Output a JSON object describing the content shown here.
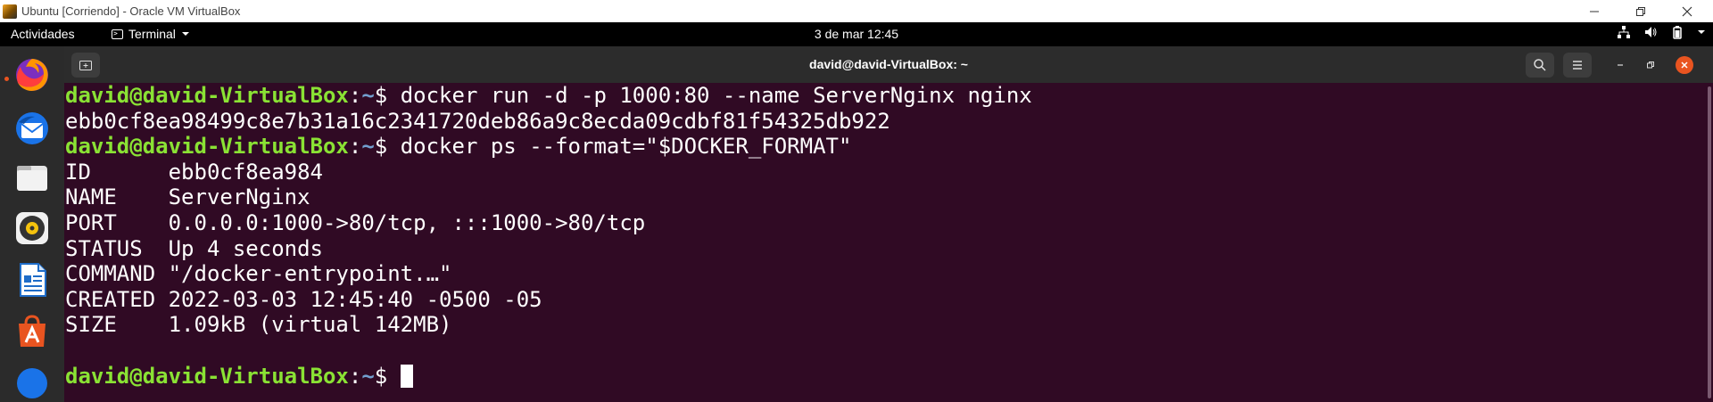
{
  "vbox": {
    "title": "Ubuntu [Corriendo] - Oracle VM VirtualBox"
  },
  "gnome": {
    "activities": "Actividades",
    "app_menu": "Terminal",
    "clock": "3 de mar  12:45"
  },
  "terminal": {
    "title": "david@david-VirtualBox: ~",
    "prompt_user": "david@david-VirtualBox",
    "prompt_sep": ":",
    "prompt_path": "~",
    "prompt_end": "$ ",
    "lines": [
      {
        "type": "prompt",
        "command": "docker run -d -p 1000:80 --name ServerNginx nginx"
      },
      {
        "type": "output",
        "text": "ebb0cf8ea98499c8e7b31a16c2341720deb86a9c8ecda09cdbf81f54325db922"
      },
      {
        "type": "prompt",
        "command": "docker ps --format=\"$DOCKER_FORMAT\""
      },
      {
        "type": "output",
        "text": "ID      ebb0cf8ea984"
      },
      {
        "type": "output",
        "text": "NAME    ServerNginx"
      },
      {
        "type": "output",
        "text": "PORT    0.0.0.0:1000->80/tcp, :::1000->80/tcp"
      },
      {
        "type": "output",
        "text": "STATUS  Up 4 seconds"
      },
      {
        "type": "output",
        "text": "COMMAND \"/docker-entrypoint.…\""
      },
      {
        "type": "output",
        "text": "CREATED 2022-03-03 12:45:40 -0500 -05"
      },
      {
        "type": "output",
        "text": "SIZE    1.09kB (virtual 142MB)"
      },
      {
        "type": "output",
        "text": ""
      },
      {
        "type": "prompt",
        "command": "",
        "cursor": true
      }
    ]
  },
  "dock": {
    "items": [
      {
        "name": "firefox-icon",
        "running": true
      },
      {
        "name": "thunderbird-icon",
        "running": false
      },
      {
        "name": "files-icon",
        "running": false
      },
      {
        "name": "rhythmbox-icon",
        "running": false
      },
      {
        "name": "libreoffice-writer-icon",
        "running": false
      },
      {
        "name": "software-center-icon",
        "running": false
      },
      {
        "name": "help-icon",
        "running": false
      }
    ]
  },
  "colors": {
    "terminal_bg": "#300a24",
    "prompt_user": "#8ae234",
    "prompt_path": "#729fcf",
    "accent": "#e95420"
  }
}
